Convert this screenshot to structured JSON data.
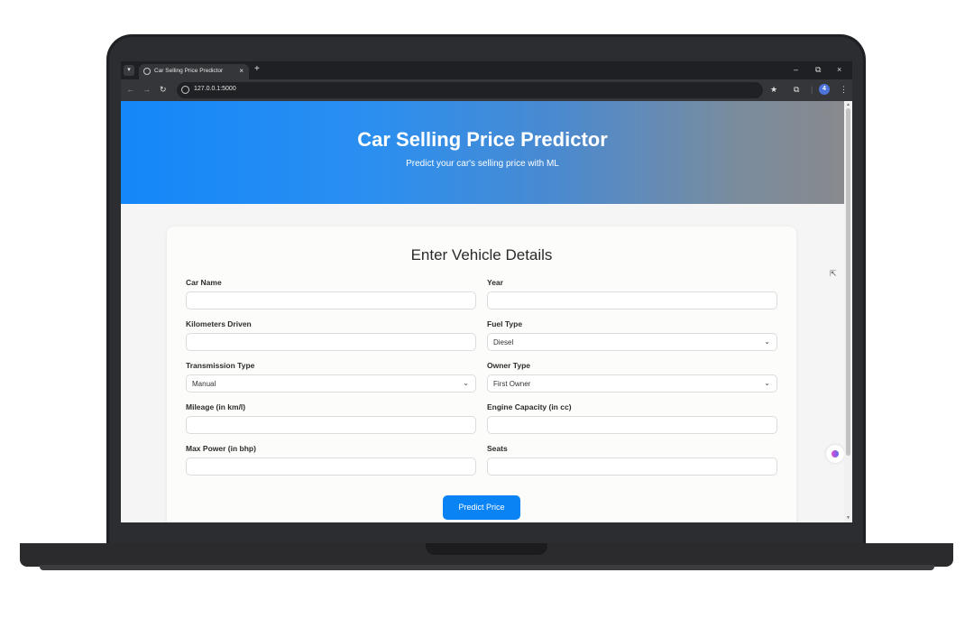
{
  "browser": {
    "tab_title": "Car Selling Price Predictor",
    "tab_close": "×",
    "new_tab": "+",
    "url": "127.0.0.1:5000",
    "profile_badge": "4",
    "window_controls": {
      "minimize": "–",
      "restore": "⧉",
      "close": "×"
    }
  },
  "hero": {
    "title": "Car Selling Price Predictor",
    "subtitle": "Predict your car's selling price with ML"
  },
  "form": {
    "title": "Enter Vehicle Details",
    "fields": [
      {
        "label": "Car Name",
        "value": ""
      },
      {
        "label": "Year",
        "value": ""
      },
      {
        "label": "Kilometers Driven",
        "value": ""
      },
      {
        "label": "Fuel Type",
        "value": "Diesel"
      },
      {
        "label": "Transmission Type",
        "value": "Manual"
      },
      {
        "label": "Owner Type",
        "value": "First Owner"
      },
      {
        "label": "Mileage (in km/l)",
        "value": ""
      },
      {
        "label": "Engine Capacity (in cc)",
        "value": ""
      },
      {
        "label": "Max Power (in bhp)",
        "value": ""
      },
      {
        "label": "Seats",
        "value": ""
      }
    ],
    "submit_label": "Predict Price"
  },
  "colors": {
    "accent": "#0a84f5",
    "hero_start": "#1487f9",
    "hero_end": "#888a8d"
  },
  "icons": [
    "chevron-down-icon",
    "globe-icon",
    "star-icon",
    "extensions-icon",
    "kebab-menu-icon",
    "back-icon",
    "forward-icon",
    "reload-icon",
    "site-info-icon"
  ]
}
